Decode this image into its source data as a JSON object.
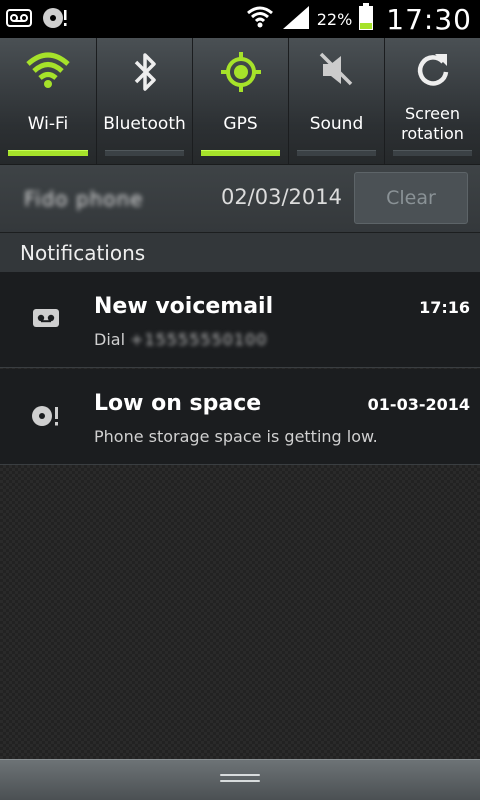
{
  "status_bar": {
    "icons": [
      "voicemail-icon",
      "storage-warning-icon"
    ],
    "right_icons": [
      "wifi-icon",
      "signal-icon",
      "battery-icon"
    ],
    "battery_percent": "22%",
    "clock": "17:30"
  },
  "quick_settings": [
    {
      "label": "Wi-Fi",
      "icon": "wifi-icon",
      "on": true
    },
    {
      "label": "Bluetooth",
      "icon": "bluetooth-icon",
      "on": false
    },
    {
      "label": "GPS",
      "icon": "gps-icon",
      "on": true
    },
    {
      "label": "Sound",
      "icon": "sound-muted-icon",
      "on": false
    },
    {
      "label_line1": "Screen",
      "label_line2": "rotation",
      "icon": "screen-rotation-icon",
      "on": false
    }
  ],
  "carrier": "Fido phone",
  "date": "02/03/2014",
  "clear_label": "Clear",
  "notifications_header": "Notifications",
  "notifications": [
    {
      "title": "New voicemail",
      "text_prefix": "Dial",
      "text_number": "+15555550100",
      "time": "17:16",
      "icon": "voicemail-icon"
    },
    {
      "title": "Low on space",
      "text": "Phone storage space is getting low.",
      "time": "01-03-2014",
      "icon": "storage-warning-icon"
    }
  ],
  "colors": {
    "accent_green": "#a6e22a"
  }
}
